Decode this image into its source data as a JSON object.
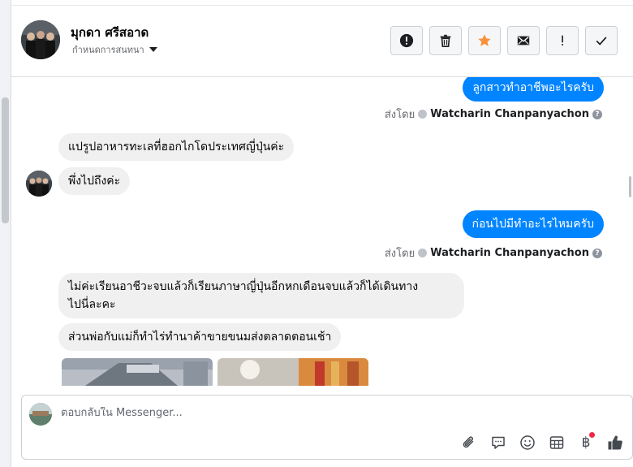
{
  "contact": {
    "name": "มุกดา ศรีสอาด",
    "assign_label": "กำหนดการสนทนา"
  },
  "actions": [
    {
      "name": "report-button",
      "icon": "alert-circle-icon"
    },
    {
      "name": "delete-button",
      "icon": "trash-icon"
    },
    {
      "name": "star-button",
      "icon": "star-icon",
      "color": "#f7923a"
    },
    {
      "name": "mark-unread-button",
      "icon": "envelope-icon"
    },
    {
      "name": "important-button",
      "icon": "exclamation-icon"
    },
    {
      "name": "done-button",
      "icon": "check-icon"
    }
  ],
  "messages": [
    {
      "direction": "out",
      "text": "ลูกสาวทำอาชีพอะไรครับ"
    },
    {
      "direction": "in",
      "text": "แปรูปอาหารทะเลที่ฮอกไกโดประเทศญี่ปุ่นค่ะ"
    },
    {
      "direction": "in",
      "text": "พึ่งไปถึงค่ะ"
    },
    {
      "direction": "out",
      "text": "ก่อนไปมีทำอะไรไหมครับ"
    },
    {
      "direction": "in",
      "text_line1": "ไม่ค่ะเรียนอาชีวะจบแล้วก็เรียนภาษาญี่ปุ่นอีกหกเดือนจบแล้วก็ได้เดินทาง",
      "text_line2": "ไปนี่ละคะ"
    },
    {
      "direction": "in",
      "text": "ส่วนพ่อกับแม่ก็ทำไร่ทำนาค้าขายขนมส่งตลาดตอนเช้า"
    }
  ],
  "sent_by": {
    "prefix": "ส่งโดย",
    "sender": "Watcharin Chanpanyachon",
    "help": "?"
  },
  "composer": {
    "placeholder": "ตอบกลับใน Messenger...",
    "tools": [
      "paperclip-icon",
      "speech-bubble-icon",
      "emoji-icon",
      "grid-icon",
      "baht-icon",
      "thumbs-up-icon"
    ],
    "baht_symbol": "฿"
  },
  "colors": {
    "outgoing_bubble": "#0084ff",
    "incoming_bubble": "#f0f0f0",
    "star": "#f7923a",
    "badge_dot": "#f02849"
  }
}
